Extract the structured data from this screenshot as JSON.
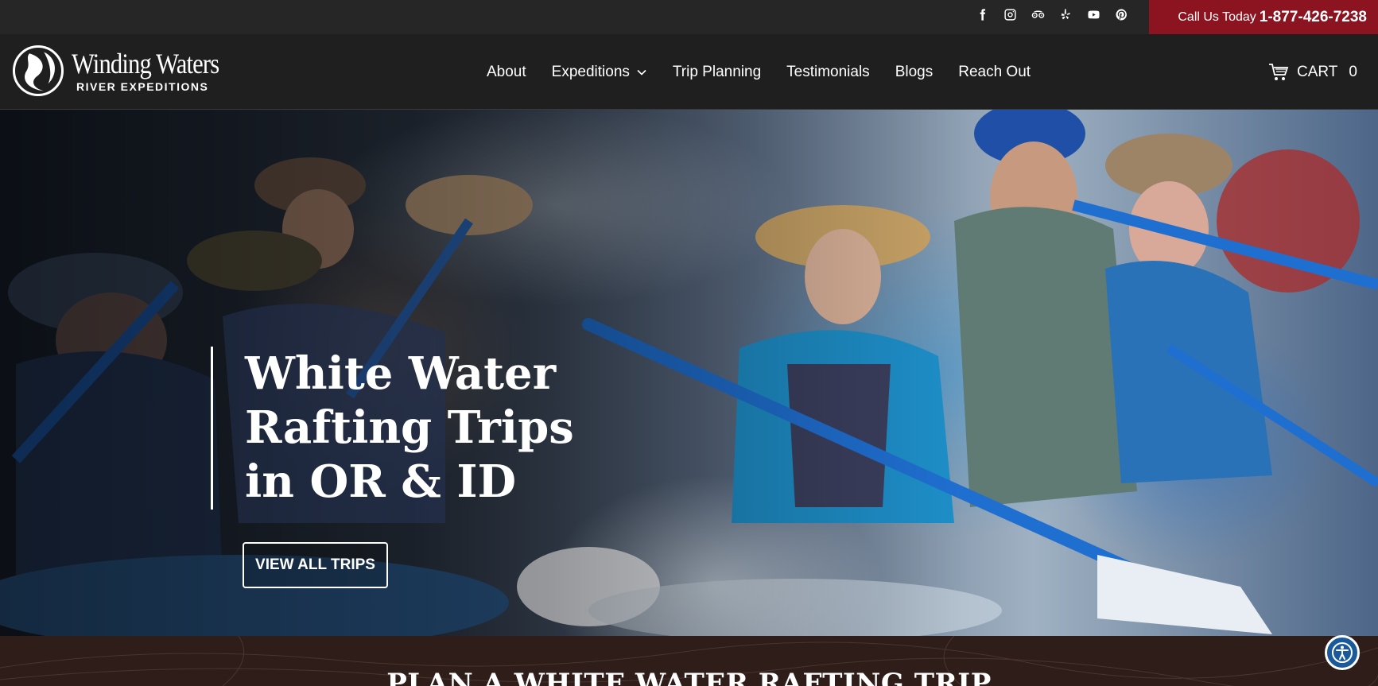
{
  "topbar": {
    "social_icons": [
      "facebook-icon",
      "instagram-icon",
      "tripadvisor-icon",
      "yelp-icon",
      "youtube-icon",
      "pinterest-icon"
    ],
    "call_label": "Call Us Today",
    "phone": "1-877-426-7238"
  },
  "logo": {
    "name": "Winding Waters",
    "subtitle": "RIVER EXPEDITIONS"
  },
  "nav": {
    "items": [
      {
        "label": "About"
      },
      {
        "label": "Expeditions"
      },
      {
        "label": "Trip Planning"
      },
      {
        "label": "Testimonials"
      },
      {
        "label": "Blogs"
      },
      {
        "label": "Reach Out"
      }
    ],
    "cart_label": "CART",
    "cart_count": "0"
  },
  "hero": {
    "title": "White Water Rafting Trips in OR & ID",
    "button_label": "VIEW ALL TRIPS"
  },
  "plan": {
    "title": "PLAN A WHITE WATER RAFTING TRIP"
  },
  "colors": {
    "topbar_bg": "#262626",
    "call_bg": "#8c1420",
    "nav_bg": "#1f1f1f",
    "plan_bg": "#2e1d19",
    "accessibility": "#1b5a9a"
  }
}
